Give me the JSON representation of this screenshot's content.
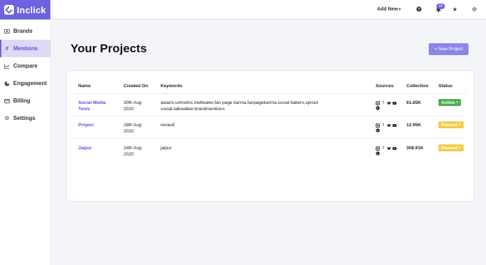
{
  "brand": {
    "name": "Inclick"
  },
  "sidebar": {
    "items": [
      {
        "label": "Brands",
        "icon": "brands-icon",
        "active": false
      },
      {
        "label": "Mentions",
        "icon": "hash-icon",
        "active": true
      },
      {
        "label": "Compare",
        "icon": "line-chart-icon",
        "active": false
      },
      {
        "label": "Engagement",
        "icon": "pie-chart-icon",
        "active": false
      },
      {
        "label": "Billing",
        "icon": "credit-card-icon",
        "active": false
      },
      {
        "label": "Settings",
        "icon": "gear-icon",
        "active": false
      }
    ]
  },
  "topbar": {
    "add_new": "Add New",
    "notification_count": "10"
  },
  "page": {
    "title": "Your Projects",
    "new_project_label": "+ New Project"
  },
  "table": {
    "columns": [
      "Name",
      "Created On",
      "Keywords",
      "Sources",
      "Collection",
      "Status"
    ],
    "rows": [
      {
        "name": "Social Media Tools",
        "created_on": "30th Aug 2020",
        "keywords": "awario,unmetric,meltwater,fan page karma,fanpagekarma,social bakers,sprout social,talkwalker,brandmentions",
        "collection": "61.65K",
        "status": "Active"
      },
      {
        "name": "Project",
        "created_on": "28th Aug 2020",
        "keywords": "renault",
        "collection": "12.95K",
        "status": "Paused"
      },
      {
        "name": "Jaipur",
        "created_on": "24th Aug 2020",
        "keywords": "jaipur",
        "collection": "308.91K",
        "status": "Paused"
      }
    ]
  },
  "colors": {
    "accent": "#6c63e0",
    "active": "#4caf50",
    "paused": "#f2cc4a"
  }
}
